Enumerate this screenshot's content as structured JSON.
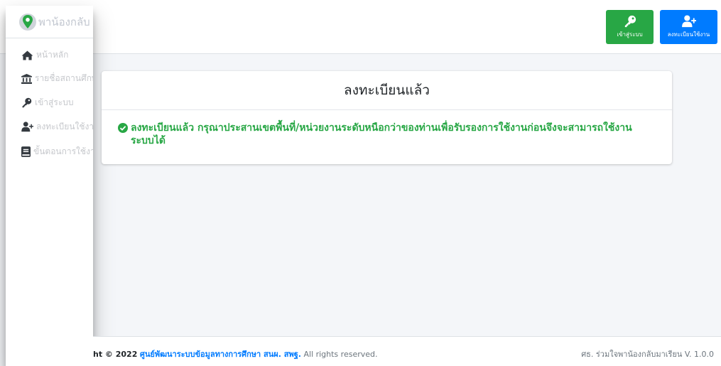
{
  "navbar": {
    "login_label": "เข้าสู่ระบบ",
    "register_label": "ลงทะเบียนใช้งาน"
  },
  "sidebar": {
    "brand": "พาน้องกลับ",
    "items": [
      {
        "label": "หน้าหลัก",
        "icon": "home-icon"
      },
      {
        "label": "รายชื่อสถานศึกษา",
        "icon": "landmark-icon"
      },
      {
        "label": "เข้าสู่ระบบ",
        "icon": "key-icon"
      },
      {
        "label": "ลงทะเบียนใช้งาน",
        "icon": "user-plus-icon"
      },
      {
        "label": "ขั้นตอนการใช้งาน",
        "icon": "book-icon"
      }
    ]
  },
  "card": {
    "title": "ลงทะเบียนแล้ว",
    "message": "ลงทะเบียนแล้ว กรุณาประสานเขตพื้นที่/หน่วยงานระดับหนือกว่าของท่านเพื่อรับรองการใช้งานก่อนจึงจะสามารถใช้งานระบบได้"
  },
  "footer": {
    "copyright_prefix": "ht © 2022",
    "org_link": "ศูนย์พัฒนาระบบข้อมูลทางการศึกษา สนผ. สพฐ.",
    "rights": "All rights reserved.",
    "right_text": "ศธ. ร่วมใจพาน้องกลับมาเรียน V. 1.0.0"
  },
  "colors": {
    "login_button": "#28a745",
    "register_button": "#007bff",
    "message_text": "#28a745",
    "brand_pin": "#28a745"
  }
}
